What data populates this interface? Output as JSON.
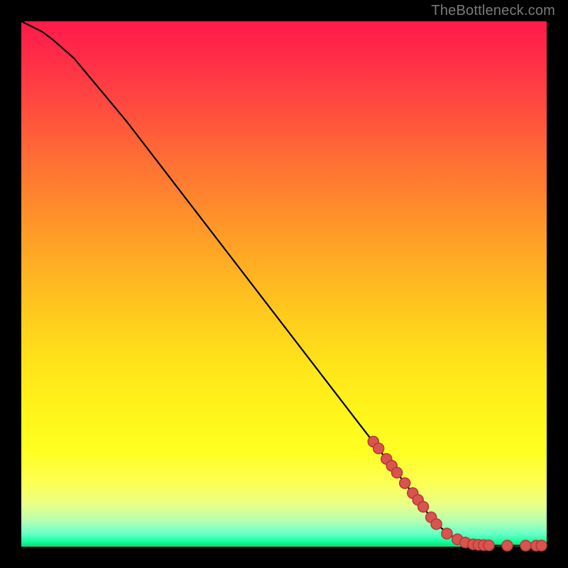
{
  "attribution": "TheBottleneck.com",
  "colors": {
    "marker_fill": "#d9534f",
    "marker_stroke": "#b03a36",
    "curve_stroke": "#000000"
  },
  "chart_data": {
    "type": "line",
    "title": "",
    "xlabel": "",
    "ylabel": "",
    "xlim": [
      0,
      100
    ],
    "ylim": [
      0,
      100
    ],
    "grid": false,
    "legend": false,
    "series": [
      {
        "name": "curve",
        "x": [
          0,
          2,
          4,
          6,
          10,
          20,
          30,
          40,
          50,
          60,
          70,
          75,
          78,
          80,
          82,
          84,
          86,
          88,
          90,
          92,
          94,
          96,
          98,
          100
        ],
        "y": [
          100,
          99,
          98,
          96.5,
          93,
          81,
          68,
          55,
          42,
          29,
          16,
          9.5,
          5.5,
          3.5,
          2.0,
          1.0,
          0.5,
          0.3,
          0.2,
          0.2,
          0.2,
          0.2,
          0.2,
          0.2
        ]
      }
    ],
    "markers": {
      "name": "points",
      "x": [
        67,
        68,
        69.5,
        70.5,
        71.5,
        73.0,
        74.5,
        75.5,
        76.5,
        78.0,
        79.0,
        81.0,
        83.0,
        84.5,
        86.0,
        87.0,
        88.0,
        89.0,
        92.5,
        96.0,
        98.0,
        99.0
      ],
      "y": [
        20.0,
        18.7,
        16.7,
        15.4,
        14.1,
        12.1,
        10.2,
        8.9,
        7.6,
        5.6,
        4.3,
        2.5,
        1.4,
        0.8,
        0.45,
        0.35,
        0.3,
        0.25,
        0.2,
        0.2,
        0.2,
        0.2
      ]
    }
  }
}
